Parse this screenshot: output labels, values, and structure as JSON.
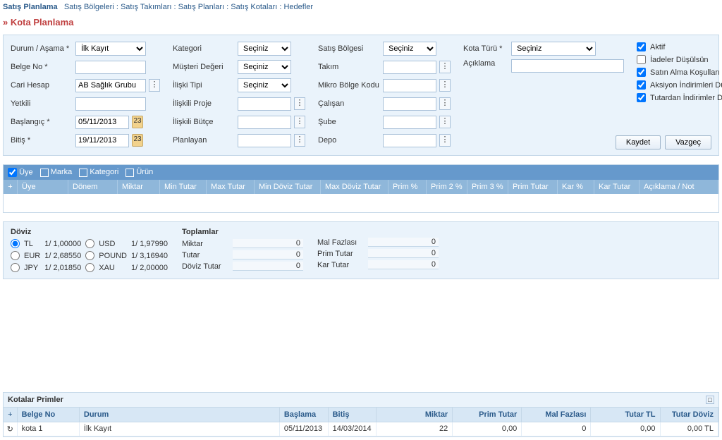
{
  "breadcrumb": {
    "main": "Satış Planlama",
    "items": [
      "Satış Bölgeleri",
      "Satış Takımları",
      "Satış Planları",
      "Satış Kotaları",
      "Hedefler"
    ]
  },
  "page_title": "» Kota Planlama",
  "form": {
    "col1": {
      "durum_label": "Durum / Aşama *",
      "durum_value": "İlk Kayıt",
      "belge_no_label": "Belge No *",
      "belge_no_value": "",
      "cari_hesap_label": "Cari Hesap",
      "cari_hesap_value": "AB Sağlık Grubu",
      "yetkili_label": "Yetkili",
      "yetkili_value": "",
      "baslangic_label": "Başlangıç *",
      "baslangic_value": "05/11/2013",
      "bitis_label": "Bitiş *",
      "bitis_value": "19/11/2013",
      "cal_icon": "23"
    },
    "col2": {
      "kategori_label": "Kategori",
      "kategori_value": "Seçiniz",
      "musteri_label": "Müşteri Değeri",
      "musteri_value": "Seçiniz",
      "iliski_tipi_label": "İlişki Tipi",
      "iliski_tipi_value": "Seçiniz",
      "iliski_proje_label": "İlişkili Proje",
      "iliski_butce_label": "İlişkili Bütçe",
      "planlayan_label": "Planlayan"
    },
    "col3": {
      "satis_bolgesi_label": "Satış Bölgesi",
      "satis_bolgesi_value": "Seçiniz",
      "takim_label": "Takım",
      "mikro_label": "Mikro Bölge Kodu",
      "calisan_label": "Çalışan",
      "sube_label": "Şube",
      "depo_label": "Depo"
    },
    "col4": {
      "kota_turu_label": "Kota Türü *",
      "kota_turu_value": "Seçiniz",
      "aciklama_label": "Açıklama"
    },
    "checks": {
      "aktif": "Aktif",
      "iadeler": "İadeler Düşülsün",
      "satin_alma": "Satın Alma Koşulları Düşülsün",
      "aksiyon": "Aksiyon İndirimleri Düşülsün",
      "tutardan": "Tutardan İndirimler Düşülsün"
    },
    "buttons": {
      "save": "Kaydet",
      "cancel": "Vazgeç"
    }
  },
  "grid": {
    "filters": [
      "Üye",
      "Marka",
      "Kategori",
      "Ürün"
    ],
    "headers": [
      "Üye",
      "Dönem",
      "Miktar",
      "Min Tutar",
      "Max Tutar",
      "Min Döviz Tutar",
      "Max Döviz Tutar",
      "Prim %",
      "Prim 2 %",
      "Prim 3 %",
      "Prim Tutar",
      "Kar %",
      "Kar Tutar",
      "Açıklama / Not"
    ]
  },
  "currency": {
    "title": "Döviz",
    "rows": [
      {
        "sym": "TL",
        "rate": "1/  1,00000",
        "checked": true
      },
      {
        "sym": "USD",
        "rate": "1/  1,97990",
        "checked": false
      },
      {
        "sym": "EUR",
        "rate": "1/  2,68550",
        "checked": false
      },
      {
        "sym": "POUND",
        "rate": "1/  3,16940",
        "checked": false
      },
      {
        "sym": "JPY",
        "rate": "1/  2,01850",
        "checked": false
      },
      {
        "sym": "XAU",
        "rate": "1/  2,00000",
        "checked": false
      }
    ]
  },
  "totals": {
    "title": "Toplamlar",
    "rows1": [
      {
        "label": "Miktar",
        "value": "0"
      },
      {
        "label": "Tutar",
        "value": "0"
      },
      {
        "label": "Döviz Tutar",
        "value": "0"
      }
    ],
    "rows2": [
      {
        "label": "Mal Fazlası",
        "value": "0"
      },
      {
        "label": "Prim Tutar",
        "value": "0"
      },
      {
        "label": "Kar Tutar",
        "value": "0"
      }
    ]
  },
  "kotalar": {
    "title": "Kotalar Primler",
    "headers": {
      "belge": "Belge No",
      "durum": "Durum",
      "baslama": "Başlama",
      "bitis": "Bitiş",
      "miktar": "Miktar",
      "prim": "Prim Tutar",
      "mal": "Mal Fazlası",
      "tutartl": "Tutar TL",
      "tutardoviz": "Tutar Döviz"
    },
    "rows": [
      {
        "belge": "kota 1",
        "durum": "İlk Kayıt",
        "baslama": "05/11/2013",
        "bitis": "14/03/2014",
        "miktar": "22",
        "prim": "0,00",
        "mal": "0",
        "tutartl": "0,00",
        "tutardoviz": "0,00 TL"
      }
    ]
  }
}
